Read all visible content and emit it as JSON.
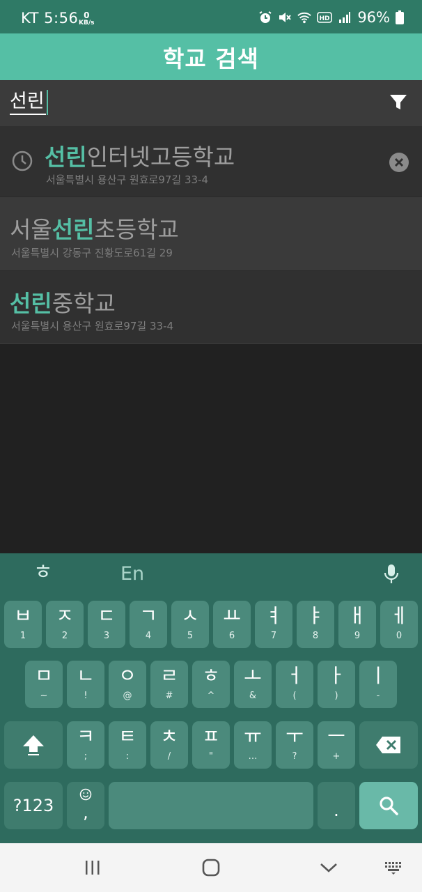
{
  "status_bar": {
    "carrier_time": "KT 5:56",
    "net_speed_value": "0",
    "net_speed_unit": "KB/s",
    "battery": "96%",
    "icons": [
      "alarm-icon",
      "mute-icon",
      "wifi-icon",
      "hd-icon",
      "signal-icon",
      "battery-icon"
    ]
  },
  "app_bar": {
    "title": "학교 검색"
  },
  "search": {
    "value": "선린",
    "filter_icon": "filter-icon"
  },
  "results": [
    {
      "is_history": true,
      "highlight": "선린",
      "name_before": "",
      "name_after": "인터넷고등학교",
      "address": "서울특별시 용산구 원효로97길 33-4"
    },
    {
      "is_history": false,
      "highlight": "선린",
      "name_before": "서울",
      "name_after": "초등학교",
      "address": "서울특별시 강동구 진황도로61길 29"
    },
    {
      "is_history": false,
      "highlight": "선린",
      "name_before": "",
      "name_after": "중학교",
      "address": "서울특별시 용산구 원효로97길 33-4"
    }
  ],
  "keyboard": {
    "toolbar": {
      "lang_hangul": "ㅎ",
      "lang_en": "En"
    },
    "row1": [
      {
        "main": "ㅂ",
        "sub": "1"
      },
      {
        "main": "ㅈ",
        "sub": "2"
      },
      {
        "main": "ㄷ",
        "sub": "3"
      },
      {
        "main": "ㄱ",
        "sub": "4"
      },
      {
        "main": "ㅅ",
        "sub": "5"
      },
      {
        "main": "ㅛ",
        "sub": "6"
      },
      {
        "main": "ㅕ",
        "sub": "7"
      },
      {
        "main": "ㅑ",
        "sub": "8"
      },
      {
        "main": "ㅐ",
        "sub": "9"
      },
      {
        "main": "ㅔ",
        "sub": "0"
      }
    ],
    "row2": [
      {
        "main": "ㅁ",
        "sub": "~"
      },
      {
        "main": "ㄴ",
        "sub": "!"
      },
      {
        "main": "ㅇ",
        "sub": "@"
      },
      {
        "main": "ㄹ",
        "sub": "#"
      },
      {
        "main": "ㅎ",
        "sub": "^"
      },
      {
        "main": "ㅗ",
        "sub": "&"
      },
      {
        "main": "ㅓ",
        "sub": "("
      },
      {
        "main": "ㅏ",
        "sub": ")"
      },
      {
        "main": "ㅣ",
        "sub": "-"
      }
    ],
    "row3": [
      {
        "main": "ㅋ",
        "sub": ";"
      },
      {
        "main": "ㅌ",
        "sub": ":"
      },
      {
        "main": "ㅊ",
        "sub": "/"
      },
      {
        "main": "ㅍ",
        "sub": "\""
      },
      {
        "main": "ㅠ",
        "sub": "…"
      },
      {
        "main": "ㅜ",
        "sub": "?"
      },
      {
        "main": "ㅡ",
        "sub": "+"
      }
    ],
    "symbols_label": "?123",
    "emoji_comma": ",",
    "period": "."
  }
}
